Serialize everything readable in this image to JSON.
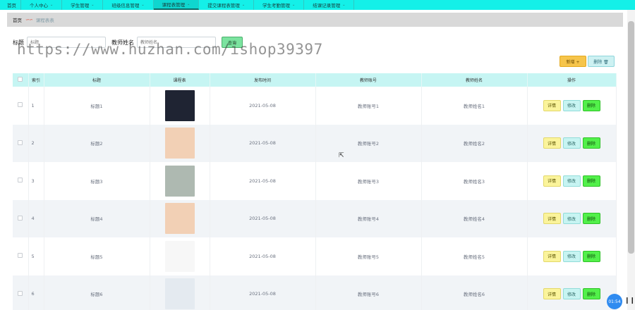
{
  "nav": {
    "items": [
      {
        "label": "首页",
        "has_dropdown": false,
        "active": false
      },
      {
        "label": "个人中心",
        "has_dropdown": true,
        "active": false
      },
      {
        "label": "学生管理",
        "has_dropdown": true,
        "active": false
      },
      {
        "label": "班级信息管理",
        "has_dropdown": true,
        "active": false
      },
      {
        "label": "课程表管理",
        "has_dropdown": true,
        "active": true
      },
      {
        "label": "提交课程表管理",
        "has_dropdown": true,
        "active": false
      },
      {
        "label": "学生考勤管理",
        "has_dropdown": true,
        "active": false
      },
      {
        "label": "结课记录管理",
        "has_dropdown": true,
        "active": false
      }
    ],
    "chevron": "⌄"
  },
  "breadcrumb": {
    "home": "首页",
    "separator": "∽∽",
    "current": "课程表表"
  },
  "search": {
    "title_label": "标题",
    "title_placeholder": "标题",
    "teacher_label": "教师姓名",
    "teacher_placeholder": "教师姓名",
    "query_button": "查询"
  },
  "watermark": "https://www.huzhan.com/ishop39397",
  "toolbar": {
    "add_button": "新增 +",
    "delete_button": "删除 🗑"
  },
  "table": {
    "headers": [
      "",
      "索引",
      "标题",
      "课程表",
      "发布时间",
      "教师账号",
      "教师姓名",
      "操作"
    ],
    "rows": [
      {
        "index": "1",
        "title": "标题1",
        "date": "2021-05-08",
        "account": "教师账号1",
        "name": "教师姓名1",
        "highlight": true
      },
      {
        "index": "2",
        "title": "标题2",
        "date": "2021-05-08",
        "account": "教师账号2",
        "name": "教师姓名2",
        "highlight": false
      },
      {
        "index": "3",
        "title": "标题3",
        "date": "2021-05-08",
        "account": "教师账号3",
        "name": "教师姓名3",
        "highlight": true
      },
      {
        "index": "4",
        "title": "标题4",
        "date": "2021-05-08",
        "account": "教师账号4",
        "name": "教师姓名4",
        "highlight": false
      },
      {
        "index": "5",
        "title": "标题5",
        "date": "2021-05-08",
        "account": "教师账号5",
        "name": "教师姓名5",
        "highlight": true
      },
      {
        "index": "6",
        "title": "标题6",
        "date": "2021-05-08",
        "account": "教师账号6",
        "name": "教师姓名6",
        "highlight": false
      }
    ],
    "ops": {
      "detail": "详情",
      "edit": "修改",
      "delete": "删除"
    }
  },
  "timer": "01:54",
  "pause_icon": "❙❙",
  "colors": {
    "nav_bg": "#14f0e8",
    "link": "#3a7bd5",
    "delete_green": "#52f04a",
    "add_orange": "#f6c54b"
  }
}
